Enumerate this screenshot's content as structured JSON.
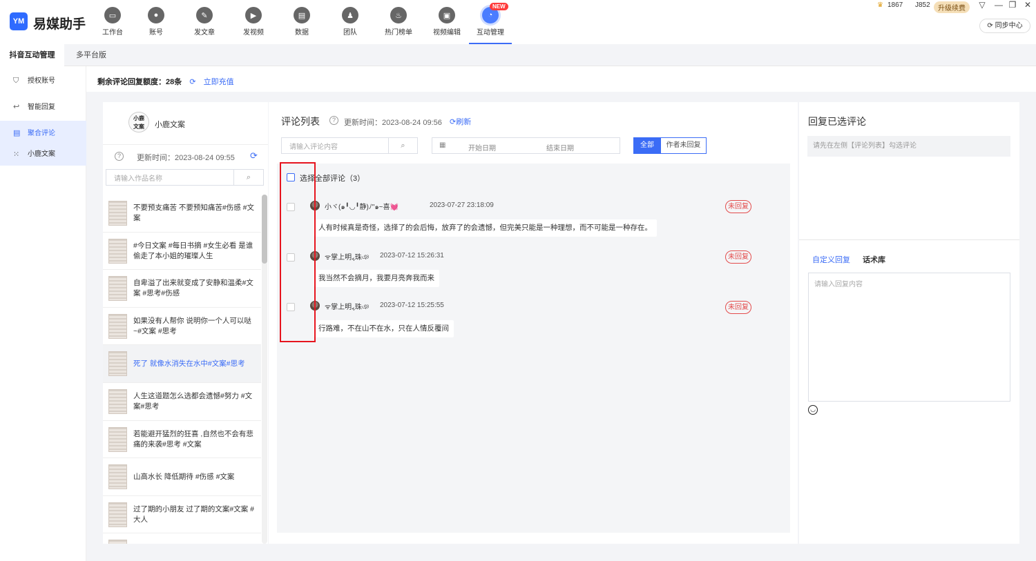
{
  "app": {
    "logo_text": "YM",
    "name": "易媒助手"
  },
  "nav": [
    {
      "label": "工作台",
      "icon": "monitor-icon"
    },
    {
      "label": "账号",
      "icon": "user-icon"
    },
    {
      "label": "发文章",
      "icon": "pen-icon"
    },
    {
      "label": "发视频",
      "icon": "play-icon"
    },
    {
      "label": "数据",
      "icon": "chart-icon"
    },
    {
      "label": "团队",
      "icon": "team-icon"
    },
    {
      "label": "热门榜单",
      "icon": "fire-icon"
    },
    {
      "label": "视频编辑",
      "icon": "briefcase-icon"
    },
    {
      "label": "互动管理",
      "icon": "chat-icon",
      "active": true,
      "badge": "NEW"
    }
  ],
  "top_right": {
    "coins": "1867",
    "user_id": "J852",
    "upgrade": "升级续费",
    "sync": "同步中心"
  },
  "tabs": {
    "primary": "抖音互动管理",
    "secondary": "多平台版"
  },
  "sidebar": [
    {
      "label": "授权账号",
      "icon": "shield-icon"
    },
    {
      "label": "智能回复",
      "icon": "reply-icon"
    },
    {
      "label": "聚合评论",
      "icon": "comments-icon",
      "active": true
    },
    {
      "label": "小鹿文案",
      "icon": "dots-icon"
    }
  ],
  "quota": {
    "label": "剩余评论回复额度：",
    "value": "28条",
    "recharge": "立即充值"
  },
  "account": {
    "avatar_text_1": "小鹿",
    "avatar_text_2": "文案",
    "name": "小鹿文案",
    "updated": "更新时间：2023-08-24 09:55",
    "search_placeholder": "请输入作品名称"
  },
  "works": [
    "不要预支痛苦 不要预知痛苦#伤感 #文案",
    "#今日文案 #每日书摘 #女生必看 是谁偷走了本小姐的璀璨人生",
    "自卑溢了出来就变成了安静和温柔#文案 #思考#伤感",
    "如果没有人帮你 说明你一个人可以哒~#文案 #思考",
    "死了 就像水消失在水中#文案#思考",
    "人生这道题怎么选都会遗憾#努力 #文案#思考",
    "若能避开猛烈的狂喜 ,自然也不会有悲痛的来袭#思考 #文案",
    "山高水长 降低期待 #伤感 #文案",
    "过了期的小朋友 过了期的文案#文案 #大人"
  ],
  "active_work_index": 4,
  "comments_panel": {
    "title": "评论列表",
    "updated": "更新时间：2023-08-24 09:56",
    "refresh": "刷新",
    "search_placeholder": "请输入评论内容",
    "start_date": "开始日期",
    "end_date": "结束日期",
    "filter_all": "全部",
    "filter_unreplied": "作者未回复",
    "select_all": "选择全部评论（3）"
  },
  "comments": [
    {
      "user": "小ヾ(๑╹◡╹静)ﾉ\"๑~喜💓",
      "time": "2023-07-27 23:18:09",
      "text": "人有时候真是奇怪，选择了的会后悔，放弃了的会遗憾，但完美只能是一种理想，而不可能是一种存在。",
      "status": "未回复"
    },
    {
      "user": "ᯤ掌上明៹珠ঞ",
      "time": "2023-07-12 15:26:31",
      "text": "我当然不会摘月，我要月亮奔我而来",
      "status": "未回复"
    },
    {
      "user": "ᯤ掌上明៹珠ঞ",
      "time": "2023-07-12 15:25:55",
      "text": "行路难，不在山不在水，只在人情反覆间",
      "status": "未回复"
    }
  ],
  "reply_panel": {
    "title": "回复已选评论",
    "hint": "请先在左侧【评论列表】勾选评论",
    "tab_custom": "自定义回复",
    "tab_library": "话术库",
    "placeholder": "请输入回复内容"
  },
  "colors": {
    "accent": "#3b6cf6",
    "annotation_red": "#e6141e",
    "status_red": "#e34b4b"
  }
}
